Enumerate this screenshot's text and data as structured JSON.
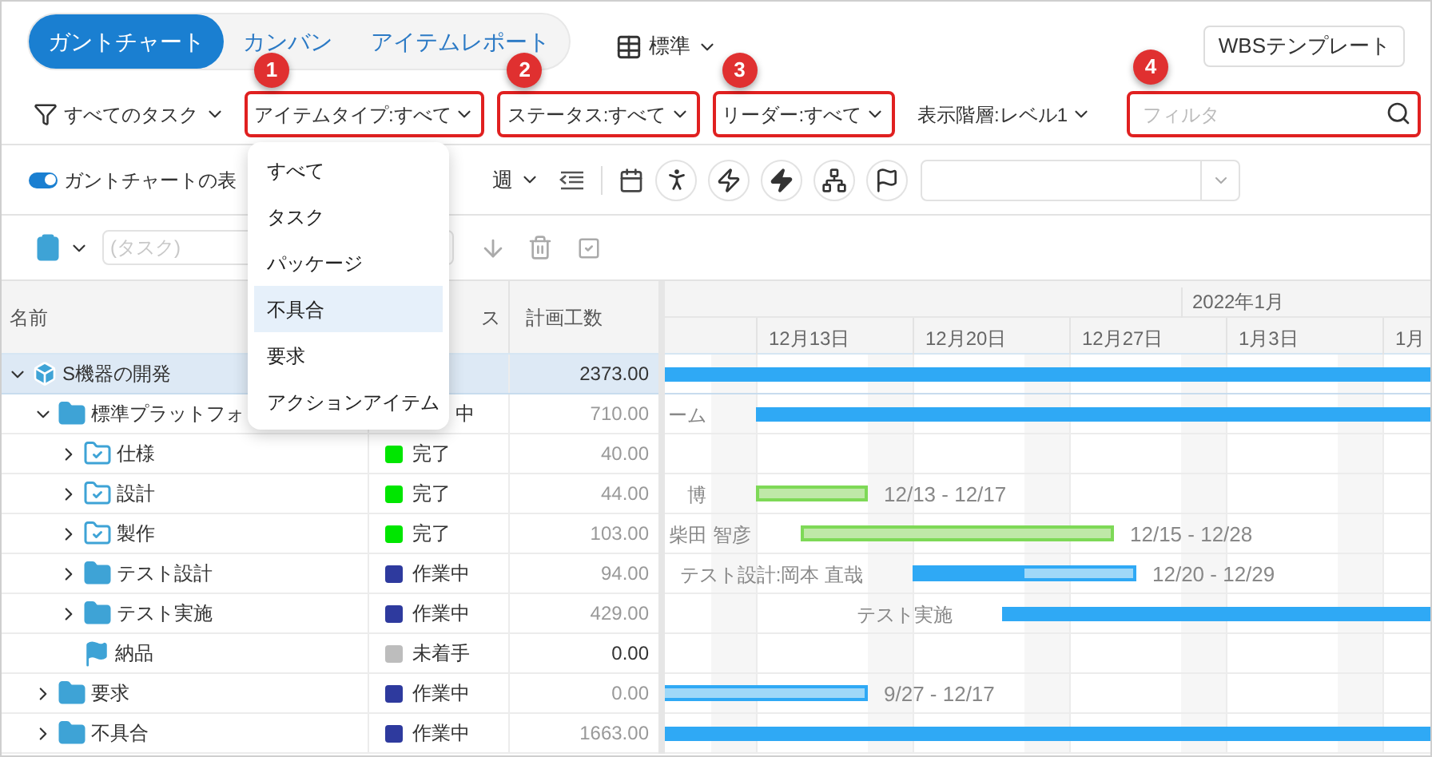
{
  "view_tabs": [
    {
      "label": "ガントチャート",
      "selected": true
    },
    {
      "label": "カンバン",
      "selected": false
    },
    {
      "label": "アイテムレポート",
      "selected": false
    }
  ],
  "layout_menu": {
    "label": "標準"
  },
  "template_button": "WBSテンプレート",
  "task_filter": {
    "label": "すべてのタスク"
  },
  "filters": [
    {
      "label": "アイテムタイプ:すべて",
      "highlighted": true,
      "badge": "1"
    },
    {
      "label": "ステータス:すべて",
      "highlighted": true,
      "badge": "2"
    },
    {
      "label": "リーダー:すべて",
      "highlighted": true,
      "badge": "3"
    },
    {
      "label": "表示階層:レベル1",
      "highlighted": false
    }
  ],
  "search": {
    "placeholder": "フィルタ",
    "highlighted": true,
    "badge": "4"
  },
  "gantt_toggle": {
    "label": "ガントチャートの表",
    "on": true
  },
  "scale": {
    "label": "週"
  },
  "task_input": {
    "placeholder": "(タスク)"
  },
  "item_type_menu": {
    "items": [
      {
        "label": "すべて",
        "selected": false
      },
      {
        "label": "タスク",
        "selected": false
      },
      {
        "label": "パッケージ",
        "selected": false
      },
      {
        "label": "不具合",
        "selected": true
      },
      {
        "label": "要求",
        "selected": false
      },
      {
        "label": "アクションアイテム",
        "selected": false
      }
    ]
  },
  "table": {
    "columns": [
      "名前",
      "ス",
      "計画工数"
    ],
    "rows": [
      {
        "name": "S機器の開発",
        "kind": "project",
        "expanded": true,
        "selected": true,
        "effort": "2373.00",
        "bar": {
          "kind": "summary"
        },
        "children": [
          {
            "name": "標準プラットフォ",
            "kind": "folder",
            "expanded": true,
            "selected": false,
            "status": {
              "text": "中"
            },
            "effort": "710.00",
            "bar": {
              "kind": "summary",
              "label": "ーム"
            },
            "children": [
              {
                "name": "仕様",
                "kind": "done-folder",
                "expanded": false,
                "selected": false,
                "status": {
                  "text": "完了",
                  "color": "#00e600"
                },
                "effort": "40.00"
              },
              {
                "name": "設計",
                "kind": "done-folder",
                "expanded": false,
                "selected": false,
                "status": {
                  "text": "完了",
                  "color": "#00e600"
                },
                "effort": "44.00",
                "bar": {
                  "kind": "done",
                  "label": "博",
                  "dates": "12/13 - 12/17"
                }
              },
              {
                "name": "製作",
                "kind": "done-folder",
                "expanded": false,
                "selected": false,
                "status": {
                  "text": "完了",
                  "color": "#00e600"
                },
                "effort": "103.00",
                "bar": {
                  "kind": "done",
                  "label": "柴田 智彦",
                  "dates": "12/15 - 12/28"
                }
              },
              {
                "name": "テスト設計",
                "kind": "folder",
                "expanded": false,
                "selected": false,
                "status": {
                  "text": "作業中",
                  "color": "#2e3a9e"
                },
                "effort": "94.00",
                "bar": {
                  "kind": "progress",
                  "level": 0.5,
                  "label": "テスト設計:岡本 直哉",
                  "dates": "12/20 - 12/29"
                }
              },
              {
                "name": "テスト実施",
                "kind": "folder",
                "expanded": false,
                "selected": false,
                "status": {
                  "text": "作業中",
                  "color": "#2e3a9e"
                },
                "effort": "429.00",
                "bar": {
                  "kind": "summary",
                  "label": "テスト実施"
                }
              },
              {
                "name": "納品",
                "kind": "milestone",
                "selected": false,
                "status": {
                  "text": "未着手",
                  "color": "#bdbdbd"
                },
                "effort": "0.00"
              }
            ]
          },
          {
            "name": "要求",
            "kind": "folder",
            "expanded": false,
            "selected": false,
            "status": {
              "text": "作業中",
              "color": "#2e3a9e"
            },
            "effort": "0.00",
            "bar": {
              "kind": "light",
              "dates": "9/27 - 12/17"
            }
          },
          {
            "name": "不具合",
            "kind": "folder",
            "expanded": false,
            "selected": false,
            "status": {
              "text": "作業中",
              "color": "#2e3a9e"
            },
            "effort": "1663.00",
            "bar": {
              "kind": "summary"
            }
          }
        ]
      }
    ]
  },
  "timeline": {
    "months": [
      "2022年1月"
    ],
    "weeks": [
      "12月13日",
      "12月20日",
      "12月27日",
      "1月3日",
      "1月"
    ]
  }
}
